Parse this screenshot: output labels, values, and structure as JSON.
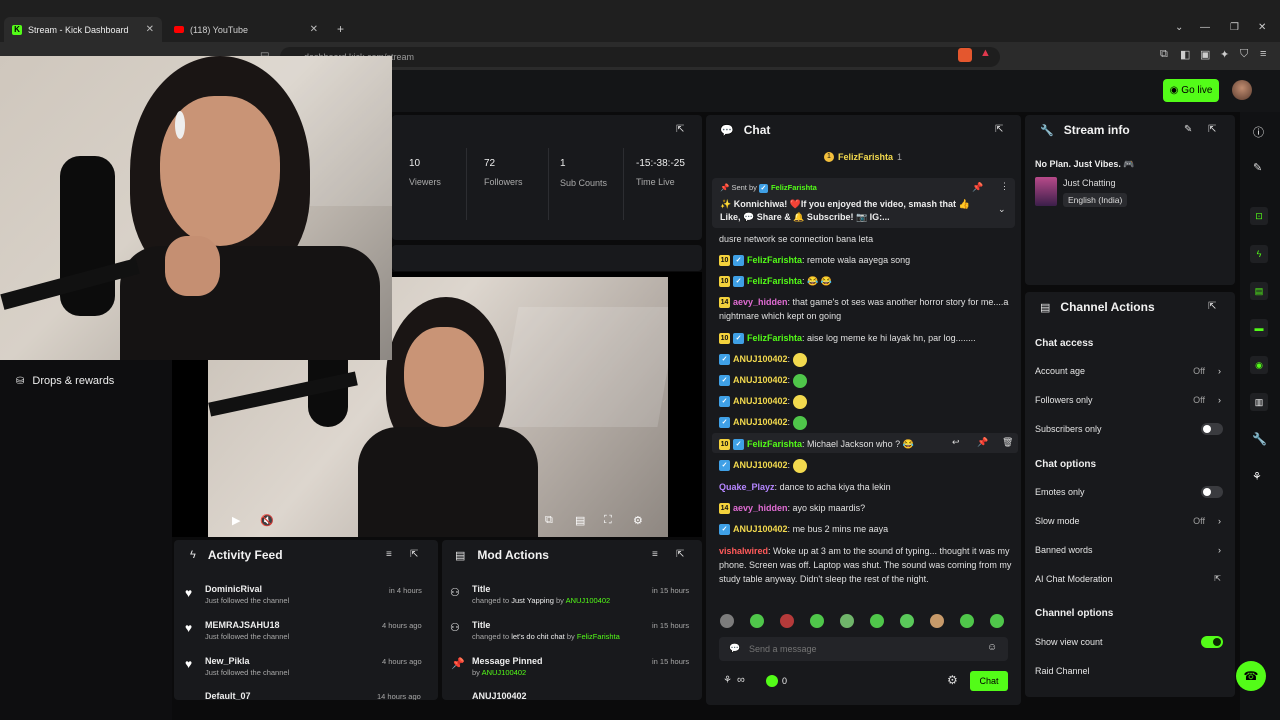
{
  "browser": {
    "tabs": [
      {
        "label": "Stream - Kick Dashboard",
        "active": true
      },
      {
        "label": "(118) YouTube",
        "active": false
      }
    ],
    "url": "dashboard.kick.com/stream"
  },
  "header": {
    "go_live": "Go live"
  },
  "stats": [
    {
      "value": "10",
      "label": "Viewers"
    },
    {
      "value": "72",
      "label": "Followers"
    },
    {
      "value": "1",
      "label": "Sub Counts"
    },
    {
      "value": "-15:-38:-25",
      "label": "Time Live"
    }
  ],
  "sidebar": {
    "drops": "Drops & rewards"
  },
  "chat": {
    "title": "Chat",
    "top_gifter": "FelizFarishta",
    "top_gifter_count": "1",
    "pinned": {
      "sent_by_label": "Sent by",
      "sent_by": "FelizFarishta",
      "text": "✨ Konnichiwa! ❤️If you enjoyed the video, smash that 👍 Like, 💬 Share & 🔔 Subscribe! 📷 IG:..."
    },
    "messages": [
      {
        "badge": "",
        "user": "",
        "text": "dusre network se connection bana leta"
      },
      {
        "badge": "10",
        "user": "FelizFarishta",
        "text": "remote wala aayega song"
      },
      {
        "badge": "10",
        "user": "FelizFarishta",
        "text": "😂 😂"
      },
      {
        "badge": "14",
        "user": "aevy_hidden",
        "text": "that game's ot ses was another horror story for me....a nightmare which kept on going"
      },
      {
        "badge": "10",
        "user": "FelizFarishta",
        "text": "aise log meme ke hi layak hn, par log........"
      },
      {
        "badge": "",
        "user": "ANUJ100402",
        "text": ""
      },
      {
        "badge": "",
        "user": "ANUJ100402",
        "text": ""
      },
      {
        "badge": "",
        "user": "ANUJ100402",
        "text": ""
      },
      {
        "badge": "",
        "user": "ANUJ100402",
        "text": ""
      },
      {
        "badge": "10",
        "user": "FelizFarishta",
        "text": "Michael Jackson who ? 😂"
      },
      {
        "badge": "",
        "user": "ANUJ100402",
        "text": ""
      },
      {
        "badge": "",
        "user": "Quake_Playz",
        "text": "dance to acha kiya tha lekin"
      },
      {
        "badge": "14",
        "user": "aevy_hidden",
        "text": "ayo skip maardis?"
      },
      {
        "badge": "",
        "user": "ANUJ100402",
        "text": "me bus 2 mins me aaya"
      },
      {
        "badge": "",
        "user": "vishalwired",
        "text": "Woke up at 3 am to the sound of typing... thought it was my phone. Screen was off. Laptop was shut. The sound was coming from my study table anyway. Didn't sleep the rest of the night."
      }
    ],
    "input_placeholder": "Send a message",
    "count": "0",
    "send": "Chat"
  },
  "stream_info": {
    "title": "Stream info",
    "stream_title": "No Plan. Just Vibes. 🎮",
    "category": "Just Chatting",
    "language": "English (India)"
  },
  "channel_actions": {
    "title": "Channel Actions",
    "chat_access": "Chat access",
    "account_age": {
      "label": "Account age",
      "value": "Off"
    },
    "followers_only": {
      "label": "Followers only",
      "value": "Off"
    },
    "subscribers_only": {
      "label": "Subscribers only",
      "on": false
    },
    "chat_options": "Chat options",
    "emotes_only": {
      "label": "Emotes only",
      "on": false
    },
    "slow_mode": {
      "label": "Slow mode",
      "value": "Off"
    },
    "banned_words": "Banned words",
    "ai_moderation": "AI Chat Moderation",
    "channel_options": "Channel options",
    "show_view_count": {
      "label": "Show view count",
      "on": true
    },
    "raid_channel": "Raid Channel"
  },
  "activity_feed": {
    "title": "Activity Feed",
    "items": [
      {
        "name": "DominicRival",
        "sub": "Just followed the channel",
        "time": "in 4 hours"
      },
      {
        "name": "MEMRAJSAHU18",
        "sub": "Just followed the channel",
        "time": "4 hours ago"
      },
      {
        "name": "New_Pikla",
        "sub": "Just followed the channel",
        "time": "4 hours ago"
      },
      {
        "name": "Default_07",
        "sub": "",
        "time": "14 hours ago"
      }
    ]
  },
  "mod_actions": {
    "title": "Mod Actions",
    "items": [
      {
        "title": "Title",
        "detail_prefix": "changed to",
        "detail": "Just Yapping",
        "by_label": "by",
        "by": "ANUJ100402",
        "time": "in 15 hours"
      },
      {
        "title": "Title",
        "detail_prefix": "changed to",
        "detail": "let's do chit chat",
        "by_label": "by",
        "by": "FelizFarishta",
        "time": "in 15 hours"
      },
      {
        "title": "Message Pinned",
        "detail_prefix": "",
        "detail": "",
        "by_label": "by",
        "by": "ANUJ100402",
        "time": "in 15 hours"
      },
      {
        "title": "ANUJ100402",
        "detail_prefix": "",
        "detail": "",
        "by_label": "",
        "by": "",
        "time": ""
      }
    ]
  },
  "colors": {
    "accent": "#53fc18",
    "panel": "#18191c",
    "bg": "#0b0b0c"
  }
}
